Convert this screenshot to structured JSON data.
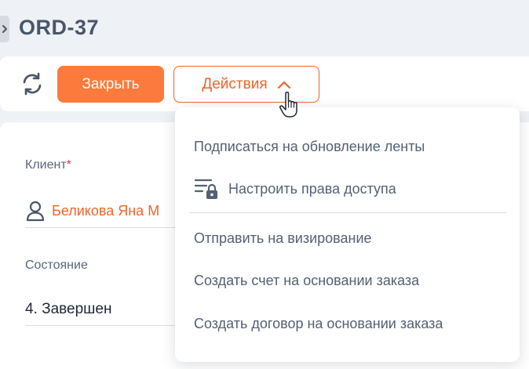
{
  "header": {
    "title": "ORD-37"
  },
  "toolbar": {
    "close_label": "Закрыть",
    "actions_label": "Действия"
  },
  "form": {
    "client_label": "Клиент",
    "client_required_mark": "*",
    "client_value": "Беликова Яна М",
    "state_label": "Состояние",
    "state_value": "4. Завершен"
  },
  "actions_menu": {
    "items": [
      {
        "label": "Подписаться на обновление ленты"
      },
      {
        "label": "Настроить права доступа",
        "icon": "lock-list-icon"
      },
      {
        "label": "Отправить на визирование"
      },
      {
        "label": "Создать счет на основании заказа"
      },
      {
        "label": "Создать договор на основании заказа"
      }
    ]
  },
  "colors": {
    "accent": "#fc7a3b",
    "accent_text": "#f0642a",
    "title": "#4a5668",
    "menu_text": "#546073",
    "background": "#eef1f5"
  }
}
